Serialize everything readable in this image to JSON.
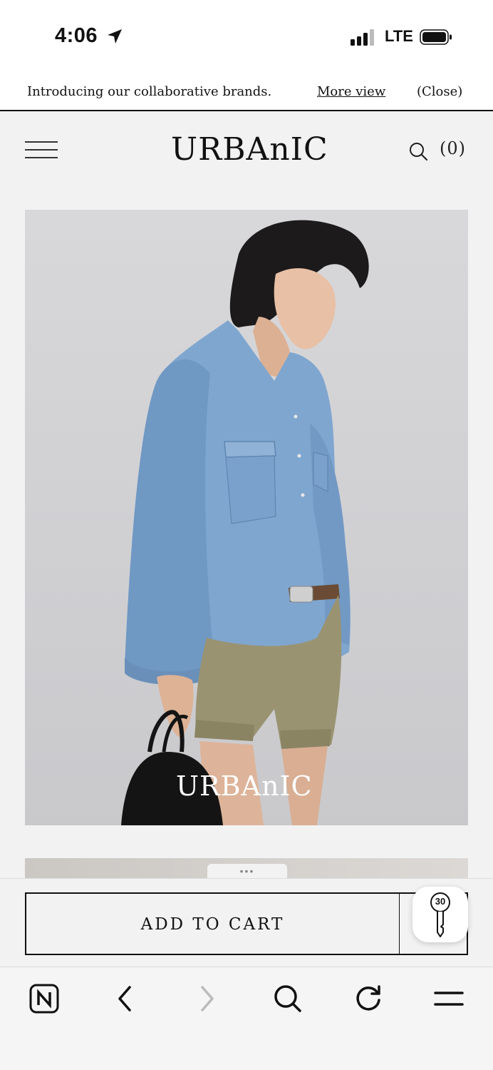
{
  "status_bar": {
    "time": "4:06",
    "network": "LTE"
  },
  "announcement": {
    "text": "Introducing our collaborative brands.",
    "more_link": "More view",
    "close_label": "(Close)"
  },
  "header": {
    "logo": "URBAnIC",
    "cart_count": "(0)"
  },
  "hero": {
    "brand_overlay": "URBAnIC",
    "description": "Model in light-blue denim shirt with khaki shorts holding a black woven bag"
  },
  "drawer_handle": "•••",
  "cart_bar": {
    "add_to_cart_label": "ADD TO CART",
    "coupon_badge": "30"
  },
  "colors": {
    "background": "#f2f2f2",
    "text": "#111111",
    "denim": "#7fa6cf",
    "khaki": "#9a9372"
  },
  "toolbar": {
    "icons": [
      "naver-icon",
      "back-icon",
      "forward-icon",
      "search-icon",
      "refresh-icon",
      "menu-icon"
    ]
  }
}
